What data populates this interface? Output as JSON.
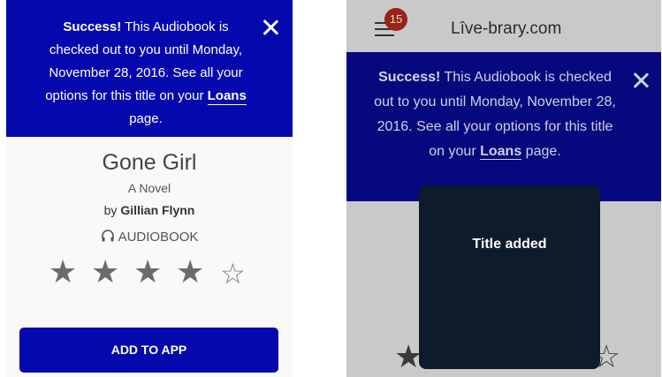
{
  "left": {
    "banner": {
      "prefix": "Success!",
      "text": " This Audiobook is checked out to you until Monday, November 28, 2016. See all your options for this title on your ",
      "link": "Loans",
      "suffix": " page."
    },
    "book": {
      "title": "Gone Girl",
      "subtitle": "A Novel",
      "by": "by ",
      "author": "Gillian Flynn",
      "format": "AUDIOBOOK",
      "rating": 4,
      "rating_max": 5
    },
    "button_label": "ADD TO APP"
  },
  "right": {
    "notifications_count": "15",
    "site_name": "Lîve-brary.com",
    "banner": {
      "prefix": "Success!",
      "text": " This Audiobook is checked out to you until Monday, November 28, 2016. See all your options for this title on your ",
      "link": "Loans",
      "suffix": " page."
    },
    "toast": "Title added"
  },
  "colors": {
    "brand_blue": "#0509ad",
    "dim_blue": "#06097e",
    "toast_bg": "#0d1b2b",
    "badge_red": "#9a2418"
  }
}
